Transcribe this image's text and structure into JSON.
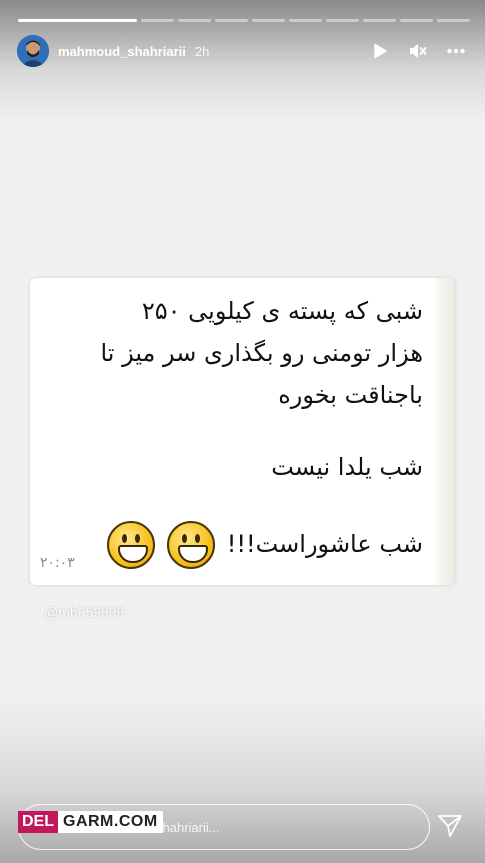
{
  "story": {
    "username": "mahmoud_shahriarii",
    "time_ago": "2h",
    "progress_segments": 10,
    "progress_completed": 1
  },
  "header_icons": [
    "play-icon",
    "mute-icon",
    "more-icon"
  ],
  "message": {
    "lines_group1": [
      "شبی که پسته ی کیلویی ۲۵۰",
      "هزار تومنی رو بگذاری سر میز تا",
      "باجناقت بخوره"
    ],
    "line_group2": "شب یلدا نیست",
    "line_group3": "شب عاشوراست!!!",
    "emoji_count": 2,
    "timestamp": "۲۰:۰۳"
  },
  "watermark": "@mb059809",
  "reply": {
    "placeholder": "shahriarii..."
  },
  "logo": {
    "part1": "DEL",
    "part2": "GARM.COM"
  },
  "colors": {
    "logo_accent": "#c2185b",
    "emoji_yellow": "#f7c11c"
  }
}
